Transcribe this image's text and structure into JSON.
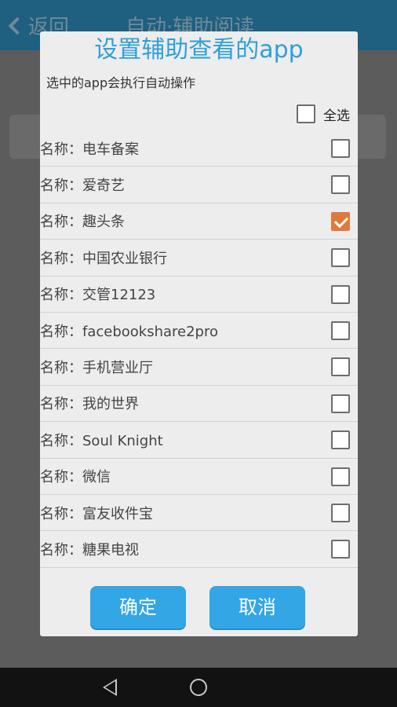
{
  "background_app": {
    "back_label": "返回",
    "title": "自动·辅助阅读"
  },
  "dialog": {
    "title": "设置辅助查看的app",
    "subtitle": "选中的app会执行自动操作",
    "select_all_label": "全选",
    "select_all_checked": false,
    "items": [
      {
        "label": "名称：电车备案",
        "checked": false
      },
      {
        "label": "名称：爱奇艺",
        "checked": false
      },
      {
        "label": "名称：趣头条",
        "checked": true
      },
      {
        "label": "名称：中国农业银行",
        "checked": false
      },
      {
        "label": "名称：交管12123",
        "checked": false
      },
      {
        "label": "名称：facebookshare2pro",
        "checked": false
      },
      {
        "label": "名称：手机营业厅",
        "checked": false
      },
      {
        "label": "名称：我的世界",
        "checked": false
      },
      {
        "label": "名称：Soul Knight",
        "checked": false
      },
      {
        "label": "名称：微信",
        "checked": false
      },
      {
        "label": "名称：富友收件宝",
        "checked": false
      },
      {
        "label": "名称：糖果电视",
        "checked": false
      }
    ],
    "confirm_label": "确定",
    "cancel_label": "取消"
  },
  "colors": {
    "accent": "#2ea0dc",
    "button": "#33a6e6",
    "checked": "#e07a3c"
  },
  "navbar": {
    "icons": [
      "back-triangle-icon",
      "home-circle-icon"
    ]
  }
}
